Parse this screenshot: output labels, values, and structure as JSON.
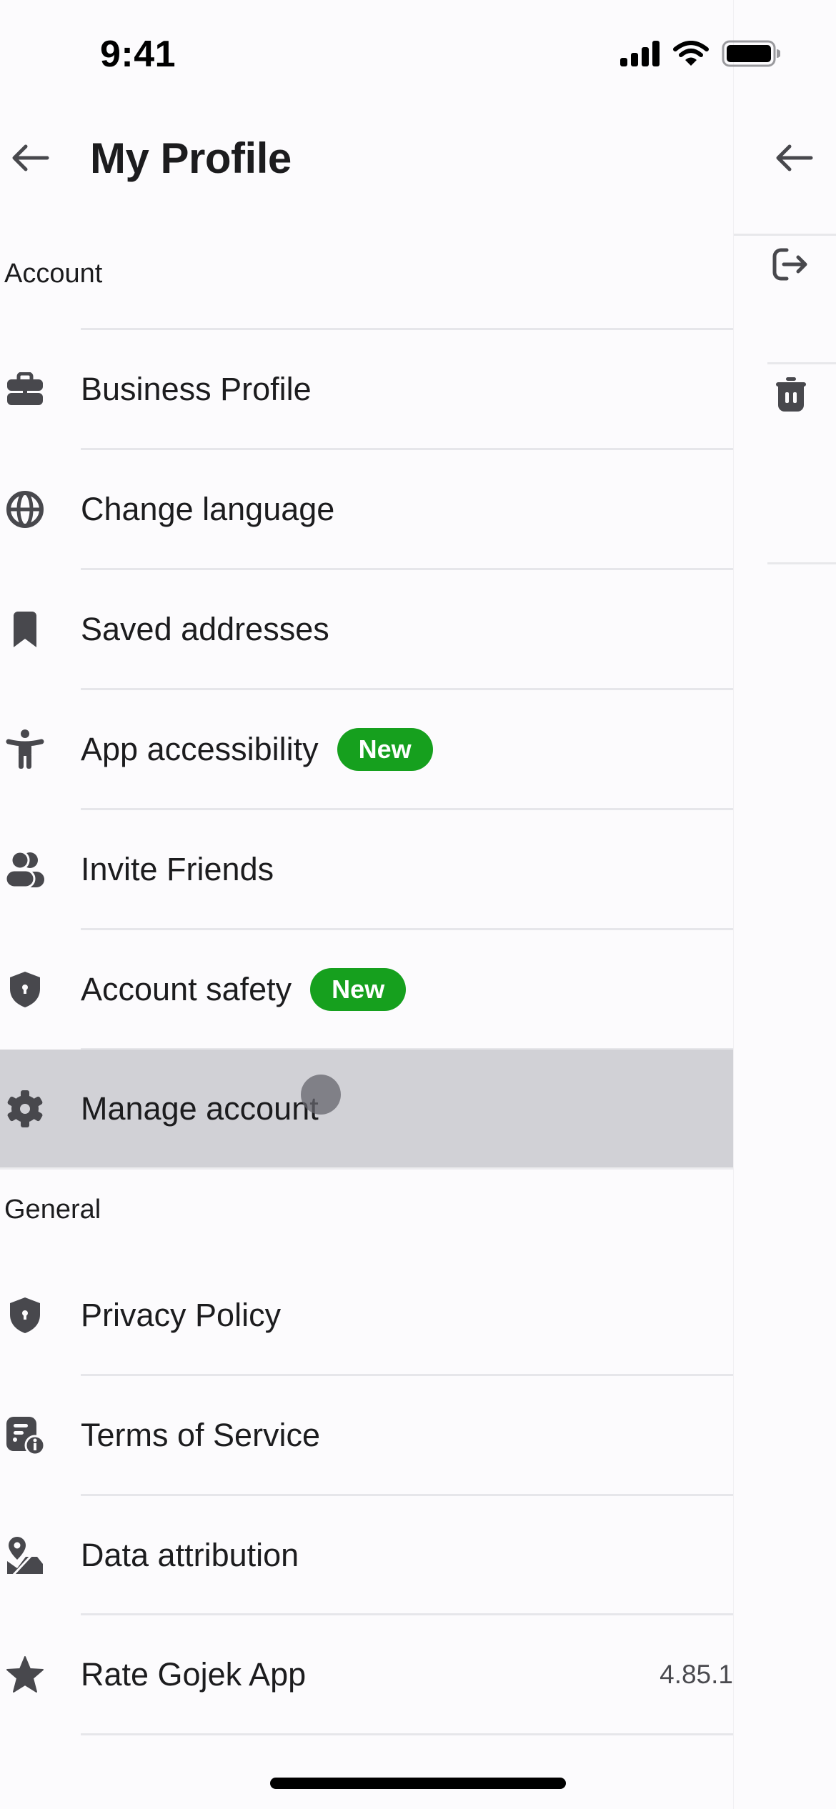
{
  "status_bar": {
    "time": "9:41",
    "icons": [
      "cellular-signal-icon",
      "wifi-icon",
      "battery-icon"
    ]
  },
  "header": {
    "back_icon": "arrow-left-icon",
    "title": "My Profile"
  },
  "sections": [
    {
      "title": "Account",
      "items": [
        {
          "label": "Business Profile",
          "icon": "briefcase-icon"
        },
        {
          "label": "Change language",
          "icon": "globe-icon"
        },
        {
          "label": "Saved addresses",
          "icon": "bookmark-icon"
        },
        {
          "label": "App accessibility",
          "icon": "accessibility-icon",
          "badge": "New"
        },
        {
          "label": "Invite Friends",
          "icon": "people-icon"
        },
        {
          "label": "Account safety",
          "icon": "shield-lock-icon",
          "badge": "New"
        },
        {
          "label": "Manage account",
          "icon": "gear-icon",
          "pressed": true
        }
      ]
    },
    {
      "title": "General",
      "items": [
        {
          "label": "Privacy Policy",
          "icon": "shield-lock-icon"
        },
        {
          "label": "Terms of Service",
          "icon": "document-info-icon"
        },
        {
          "label": "Data attribution",
          "icon": "map-pin-icon"
        },
        {
          "label": "Rate Gojek App",
          "icon": "star-icon",
          "trailing": "4.85.1"
        }
      ]
    }
  ],
  "right_panel": {
    "back_icon": "arrow-left-icon",
    "actions": [
      "logout-icon",
      "trash-icon"
    ]
  },
  "colors": {
    "badge_green": "#16a01e",
    "icon_gray": "#48484d",
    "pressed_row": "#d1d1d6",
    "background": "#fcfbfd"
  }
}
